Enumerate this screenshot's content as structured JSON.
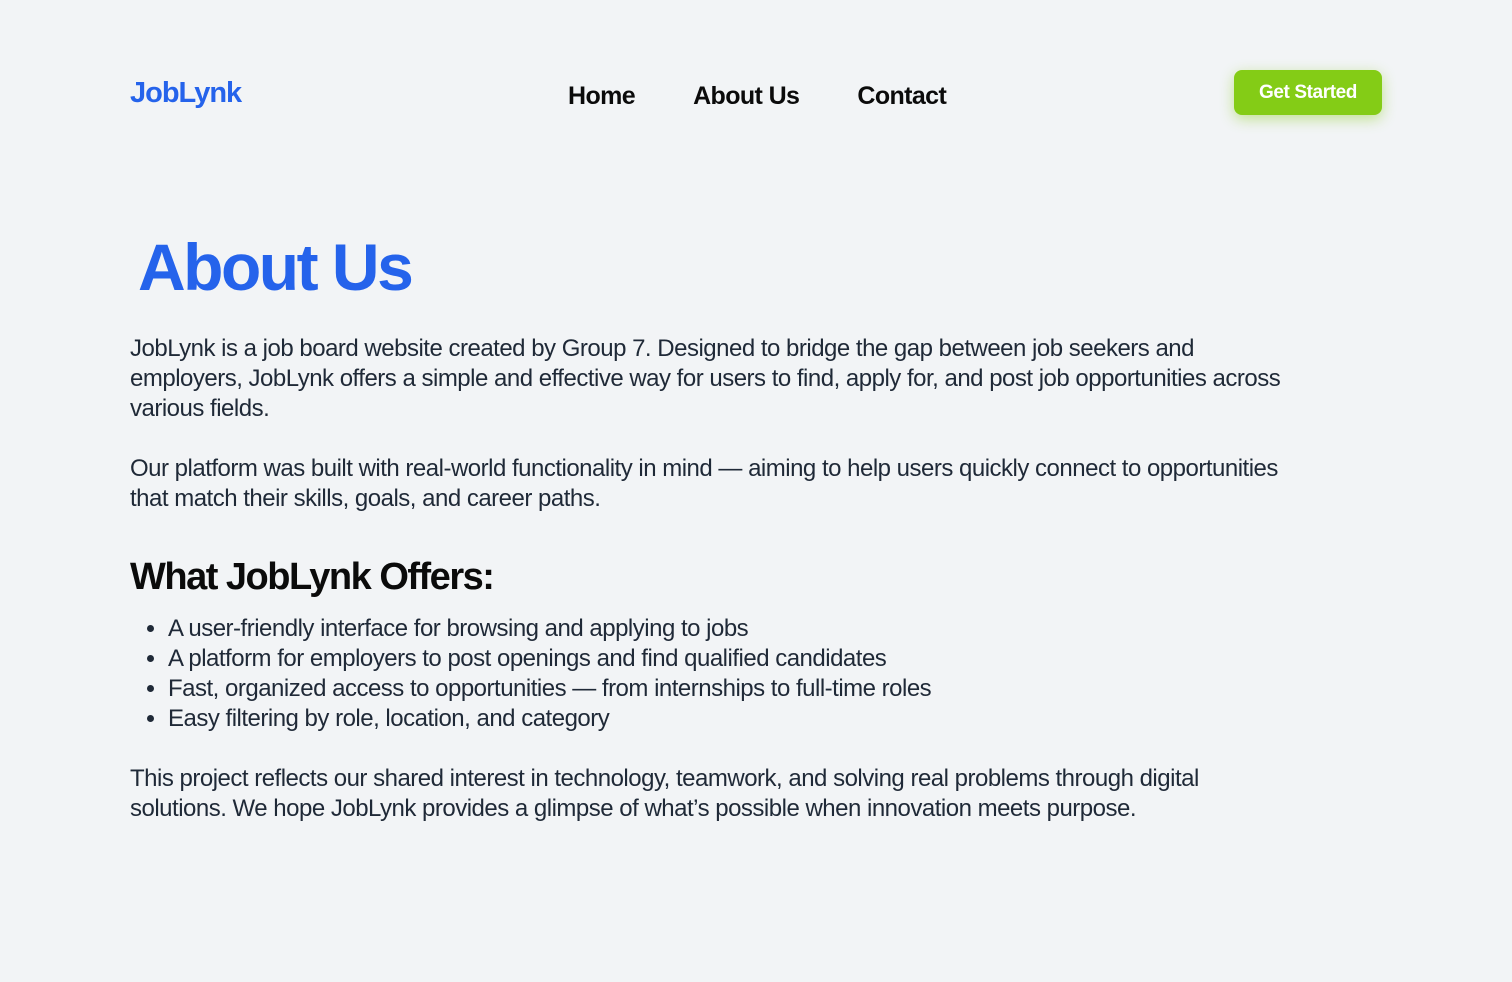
{
  "header": {
    "logo": "JobLynk",
    "nav": [
      {
        "label": "Home"
      },
      {
        "label": "About Us"
      },
      {
        "label": "Contact"
      }
    ],
    "cta_label": "Get Started"
  },
  "main": {
    "title": "About Us",
    "intro": "JobLynk is a job board website created by Group 7. Designed to bridge the gap between job seekers and employers, JobLynk offers a simple and effective way for users to find, apply for, and post job opportunities across various fields.",
    "platform": "Our platform was built with real-world functionality in mind — aiming to help users quickly connect to opportunities that match their skills, goals, and career paths.",
    "offers_title": "What JobLynk Offers:",
    "offers": [
      "A user-friendly interface for browsing and applying to jobs",
      "A platform for employers to post openings and find qualified candidates",
      "Fast, organized access to opportunities — from internships to full-time roles",
      "Easy filtering by role, location, and category"
    ],
    "closing": "This project reflects our shared interest in technology, teamwork, and solving real problems through digital solutions. We hope JobLynk provides a glimpse of what’s possible when innovation meets purpose."
  },
  "colors": {
    "brand_blue": "#2563eb",
    "cta_green": "#84cc16",
    "background": "#f2f4f6"
  }
}
